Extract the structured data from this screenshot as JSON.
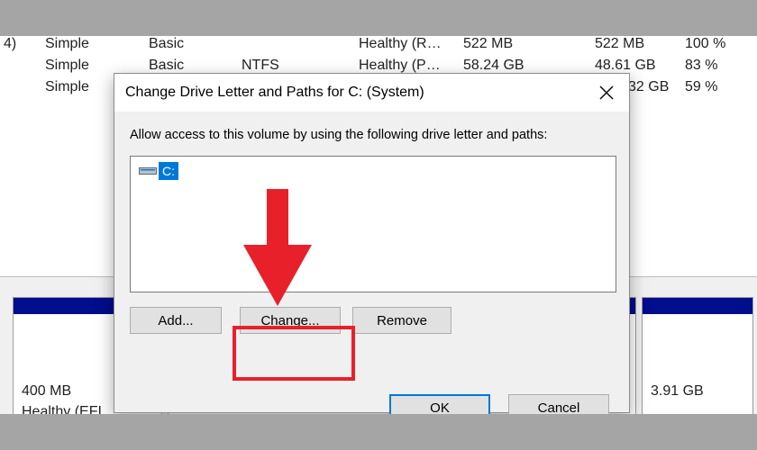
{
  "volume_list": {
    "rows": [
      {
        "volume": "4)",
        "layout": "Simple",
        "type": "Basic",
        "fs": "",
        "status": "Healthy (R…",
        "capacity": "522 MB",
        "free": "522 MB",
        "pct": "100 %"
      },
      {
        "volume": "",
        "layout": "Simple",
        "type": "Basic",
        "fs": "NTFS",
        "status": "Healthy (P…",
        "capacity": "58.24 GB",
        "free": "48.61 GB",
        "pct": "83 %"
      },
      {
        "volume": "",
        "layout": "Simple",
        "type": "",
        "fs": "",
        "status": "",
        "capacity": "",
        "free": "32 GB",
        "pct": "59 %"
      }
    ]
  },
  "disk_map": {
    "left_size": "400 MB",
    "left_status": "Healthy (EFI",
    "right_size": "3.91 GB"
  },
  "dialog": {
    "title": "Change Drive Letter and Paths for C: (System)",
    "instruction": "Allow access to this volume by using the following drive letter and paths:",
    "drive_item": "C:",
    "buttons": {
      "add": "Add...",
      "change": "Change...",
      "remove": "Remove",
      "ok": "OK",
      "cancel": "Cancel"
    }
  },
  "annotation": {
    "color": "#e8202a"
  }
}
